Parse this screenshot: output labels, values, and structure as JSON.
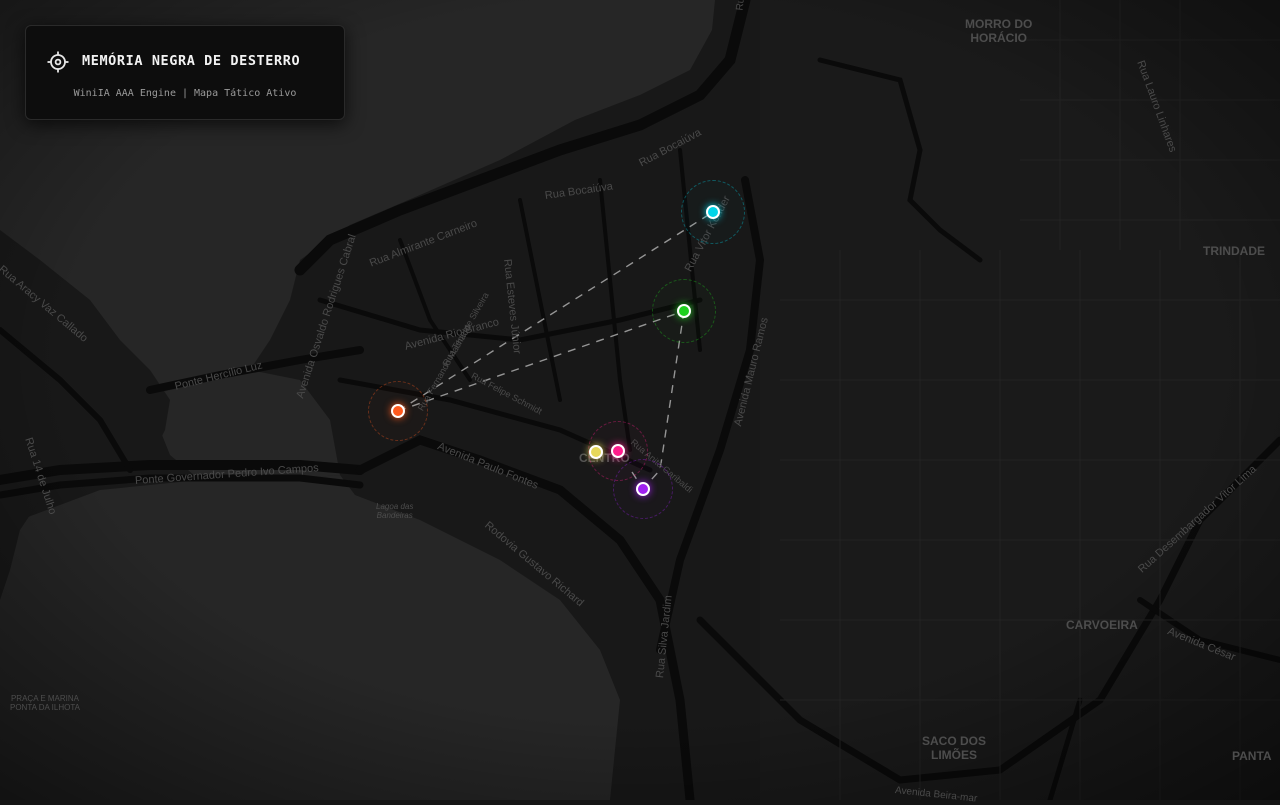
{
  "panel": {
    "title": "MEMÓRIA NEGRA DE DESTERRO",
    "subtitle": "WiniIA AAA Engine | Mapa Tático Ativo",
    "icon": "crosshair-icon"
  },
  "districts": [
    {
      "id": "morro-do-horacio",
      "text": "MORRO DO\nHORÁCIO"
    },
    {
      "id": "trindade",
      "text": "TRINDADE"
    },
    {
      "id": "carvoeira",
      "text": "CARVOEIRA"
    },
    {
      "id": "saco-dos-limoes",
      "text": "SACO DOS\nLIMÕES"
    },
    {
      "id": "pantanal",
      "text": "PANTA"
    },
    {
      "id": "centro",
      "text": "CENTRO"
    }
  ],
  "places": [
    {
      "id": "lagoa",
      "text": "Lagoa das\nBandeiras"
    },
    {
      "id": "praca-marina",
      "text": "PRAÇA E MARINA\nPONTA DA ILHOTA"
    }
  ],
  "streets": [
    {
      "id": "rua-bocaiuva-1",
      "text": "Rua Bocaiúva"
    },
    {
      "id": "rua-bocaiuva-2",
      "text": "Rua Bocaiúva"
    },
    {
      "id": "rua-almirante-carneiro",
      "text": "Rua Almirante Carneiro"
    },
    {
      "id": "rua-osvaldo-rodrigues-cabral",
      "text": "Avenida Osvaldo Rodrigues Cabral"
    },
    {
      "id": "avenida-rio-branco",
      "text": "Avenida Rio Branco"
    },
    {
      "id": "ponte-hercilio-luz",
      "text": "Ponte Hercílio Luz"
    },
    {
      "id": "ponte-pedro-ivo",
      "text": "Ponte Governador Pedro Ivo Campos"
    },
    {
      "id": "avenida-paulo-fontes",
      "text": "Avenida Paulo Fontes"
    },
    {
      "id": "rodovia-gustavo-richard",
      "text": "Rodovia Gustavo Richard"
    },
    {
      "id": "avenida-mauro-ramos",
      "text": "Avenida Mauro Ramos"
    },
    {
      "id": "rua-vitor-konder",
      "text": "Rua Vitor Konder"
    },
    {
      "id": "rua-esteves-junior",
      "text": "Rua Esteves Júnior"
    },
    {
      "id": "rua-silva-jardim",
      "text": "Rua Silva Jardim"
    },
    {
      "id": "rua-lauro-linhares",
      "text": "Rua Lauro Linhares"
    },
    {
      "id": "rua-desembargador-vitor-lima",
      "text": "Rua Desembargador Vitor Lima"
    },
    {
      "id": "avenida-cesar",
      "text": "Avenida César"
    },
    {
      "id": "rua-14-julho",
      "text": "Rua 14 de Julho"
    },
    {
      "id": "rua-aracy",
      "text": "Rua Aracy Vaz Callado"
    },
    {
      "id": "rua-felipe-schmidt",
      "text": "Rua Felipe Schmidt"
    },
    {
      "id": "rua-anita-garibaldi",
      "text": "Rua Anita Garibaldi"
    },
    {
      "id": "rua-fernando-machado",
      "text": "Rua Fernando Machado"
    },
    {
      "id": "rua-tenente-silveira",
      "text": "Rua Tenente Silveira"
    },
    {
      "id": "avenida-beira",
      "text": "Avenida Beira-mar"
    },
    {
      "id": "rua-julio-moura",
      "text": "Rua Júlio Moura"
    }
  ],
  "markers": [
    {
      "id": "cyan",
      "color": "#00d4e8"
    },
    {
      "id": "green",
      "color": "#1fd11f"
    },
    {
      "id": "orange",
      "color": "#ff5a1f"
    },
    {
      "id": "yellow",
      "color": "#e6d85a"
    },
    {
      "id": "magenta",
      "color": "#ff1e8c"
    },
    {
      "id": "purple",
      "color": "#a020f0"
    }
  ],
  "colors": {
    "background": "#151515",
    "water": "#262626",
    "roads": "#0b0b0b",
    "route": "#bfbfbf"
  }
}
